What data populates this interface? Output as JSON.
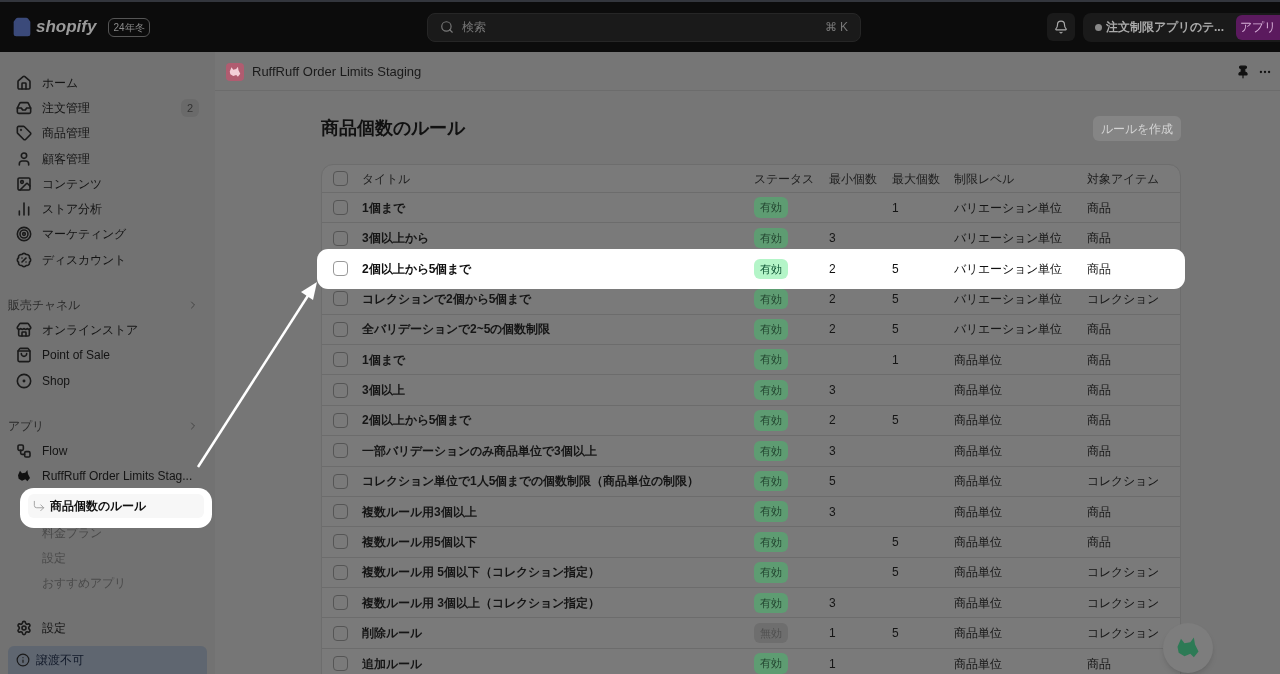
{
  "topbar": {
    "logo": "shopify",
    "edition": "24年冬",
    "search": {
      "placeholder": "検索",
      "shortcut": "⌘ K"
    },
    "store": "注文制限アプリのテ...",
    "avatar": "アプリ"
  },
  "sidebar": {
    "items": [
      {
        "kind": "home",
        "label": "ホーム"
      },
      {
        "kind": "orders",
        "label": "注文管理",
        "count": "2"
      },
      {
        "kind": "products",
        "label": "商品管理"
      },
      {
        "kind": "customers",
        "label": "顧客管理"
      },
      {
        "kind": "content",
        "label": "コンテンツ"
      },
      {
        "kind": "analytics",
        "label": "ストア分析"
      },
      {
        "kind": "marketing",
        "label": "マーケティング"
      },
      {
        "kind": "discounts",
        "label": "ディスカウント"
      }
    ],
    "sections": [
      {
        "title": "販売チャネル",
        "items": [
          {
            "kind": "store",
            "label": "オンラインストア"
          },
          {
            "kind": "pos",
            "label": "Point of Sale"
          },
          {
            "kind": "shop",
            "label": "Shop"
          }
        ]
      },
      {
        "title": "アプリ",
        "items": [
          {
            "kind": "flow",
            "label": "Flow"
          },
          {
            "kind": "dog",
            "label": "RuffRuff Order Limits Stag...",
            "children": [
              {
                "label": "商品個数のルール",
                "selected": true
              },
              {
                "label": "料金プラン",
                "selected": false
              },
              {
                "label": "設定",
                "selected": false
              },
              {
                "label": "おすすめアプリ",
                "selected": false
              }
            ]
          }
        ]
      }
    ],
    "settings": "設定",
    "notice": "譲渡不可"
  },
  "app_header": {
    "title": "RuffRuff Order Limits Staging"
  },
  "page": {
    "title": "商品個数のルール",
    "create_button": "ルールを作成"
  },
  "table": {
    "select_all_checked": false,
    "columns": [
      "タイトル",
      "ステータス",
      "最小個数",
      "最大個数",
      "制限レベル",
      "対象アイテム"
    ],
    "rows": [
      {
        "checked": false,
        "title": "1個まで",
        "status": "有効",
        "active": true,
        "max": "1",
        "level": "バリエーション単位",
        "target": "商品",
        "highlighted": false
      },
      {
        "checked": false,
        "title": "3個以上から",
        "status": "有効",
        "active": true,
        "min": "3",
        "level": "バリエーション単位",
        "target": "商品",
        "highlighted": false
      },
      {
        "checked": false,
        "title": "2個以上から5個まで",
        "status": "有効",
        "active": true,
        "min": "2",
        "max": "5",
        "level": "バリエーション単位",
        "target": "商品",
        "highlighted": true
      },
      {
        "checked": false,
        "title": "コレクションで2個から5個まで",
        "status": "有効",
        "active": true,
        "min": "2",
        "max": "5",
        "level": "バリエーション単位",
        "target": "コレクション",
        "highlighted": false
      },
      {
        "checked": false,
        "title": "全バリデーションで2~5の個数制限",
        "status": "有効",
        "active": true,
        "min": "2",
        "max": "5",
        "level": "バリエーション単位",
        "target": "商品",
        "highlighted": false
      },
      {
        "checked": false,
        "title": "1個まで",
        "status": "有効",
        "active": true,
        "max": "1",
        "level": "商品単位",
        "target": "商品",
        "highlighted": false
      },
      {
        "checked": false,
        "title": "3個以上",
        "status": "有効",
        "active": true,
        "min": "3",
        "level": "商品単位",
        "target": "商品",
        "highlighted": false
      },
      {
        "checked": false,
        "title": "2個以上から5個まで",
        "status": "有効",
        "active": true,
        "min": "2",
        "max": "5",
        "level": "商品単位",
        "target": "商品",
        "highlighted": false
      },
      {
        "checked": false,
        "title": "一部バリデーションのみ商品単位で3個以上",
        "status": "有効",
        "active": true,
        "min": "3",
        "level": "商品単位",
        "target": "商品",
        "highlighted": false
      },
      {
        "checked": false,
        "title": "コレクション単位で1人5個までの個数制限（商品単位の制限）",
        "status": "有効",
        "active": true,
        "min": "5",
        "level": "商品単位",
        "target": "コレクション",
        "highlighted": false
      },
      {
        "checked": false,
        "title": "複数ルール用3個以上",
        "status": "有効",
        "active": true,
        "min": "3",
        "level": "商品単位",
        "target": "商品",
        "highlighted": false
      },
      {
        "checked": false,
        "title": "複数ルール用5個以下",
        "status": "有効",
        "active": true,
        "max": "5",
        "level": "商品単位",
        "target": "商品",
        "highlighted": false
      },
      {
        "checked": false,
        "title": "複数ルール用 5個以下（コレクション指定）",
        "status": "有効",
        "active": true,
        "max": "5",
        "level": "商品単位",
        "target": "コレクション",
        "highlighted": false
      },
      {
        "checked": false,
        "title": "複数ルール用 3個以上（コレクション指定）",
        "status": "有効",
        "active": true,
        "min": "3",
        "level": "商品単位",
        "target": "コレクション",
        "highlighted": false
      },
      {
        "checked": false,
        "title": "削除ルール",
        "status": "無効",
        "active": false,
        "min": "1",
        "max": "5",
        "level": "商品単位",
        "target": "コレクション",
        "highlighted": false
      },
      {
        "checked": false,
        "title": "追加ルール",
        "status": "有効",
        "active": true,
        "min": "1",
        "level": "商品単位",
        "target": "商品",
        "highlighted": false
      }
    ]
  }
}
